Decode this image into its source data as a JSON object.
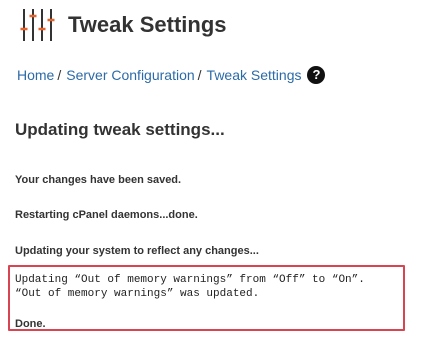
{
  "header": {
    "title": "Tweak Settings",
    "logo_icon": "sliders-icon"
  },
  "breadcrumb": {
    "items": [
      {
        "label": "Home",
        "separator": "/"
      },
      {
        "label": "Server Configuration",
        "separator": "/"
      },
      {
        "label": "Tweak Settings"
      }
    ],
    "help_icon": "?"
  },
  "main": {
    "section_title": "Updating tweak settings...",
    "status_lines": [
      "Your changes have been saved.",
      "Restarting cPanel daemons...done.",
      "Updating your system to reflect any changes..."
    ],
    "log_lines": [
      "Updating “Out of memory warnings” from “Off” to “On”.",
      "“Out of memory warnings” was updated."
    ],
    "done_text": "Done."
  },
  "colors": {
    "link": "#2b6aa8",
    "highlight_border": "#d94452",
    "logo_accent": "#e8632c"
  }
}
